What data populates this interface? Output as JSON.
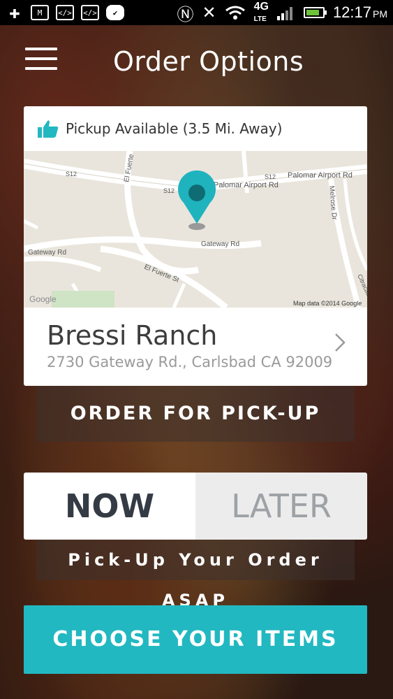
{
  "statusbar": {
    "network": "4G",
    "network_sub": "LTE",
    "time": "12:17",
    "ampm": "PM",
    "icons": [
      "plus-icon",
      "gmail-icon",
      "code-icon",
      "code-icon",
      "check-bubble-icon",
      "nfc-icon",
      "mute-icon",
      "wifi-icon",
      "signal-icon",
      "battery-icon"
    ]
  },
  "header": {
    "title": "Order Options"
  },
  "pickup": {
    "text": "Pickup Available (3.5 Mi. Away)"
  },
  "map": {
    "labels": {
      "palomar1": "Palomar Airport Rd",
      "palomar2": "Palomar Airport Rd",
      "s12a": "S12",
      "s12b": "S12",
      "s12c": "S12",
      "el_fuerte_v": "El Fuerte",
      "el_fuerte_st": "El Fuerte St",
      "gateway1": "Gateway Rd",
      "gateway2": "Gateway Rd",
      "melrose": "Melrose Dr",
      "citracado": "Citracado",
      "google": "Google",
      "attribution": "Map data ©2014 Google"
    }
  },
  "location": {
    "name": "Bressi Ranch",
    "address": "2730 Gateway Rd., Carlsbad CA 92009"
  },
  "buttons": {
    "order_pickup": "ORDER FOR PICK-UP",
    "now": "NOW",
    "later": "LATER",
    "asap": "Pick-Up Your Order ASAP",
    "choose": "CHOOSE YOUR ITEMS"
  },
  "colors": {
    "accent": "#22b8c1",
    "pin": "#1fb3be"
  }
}
